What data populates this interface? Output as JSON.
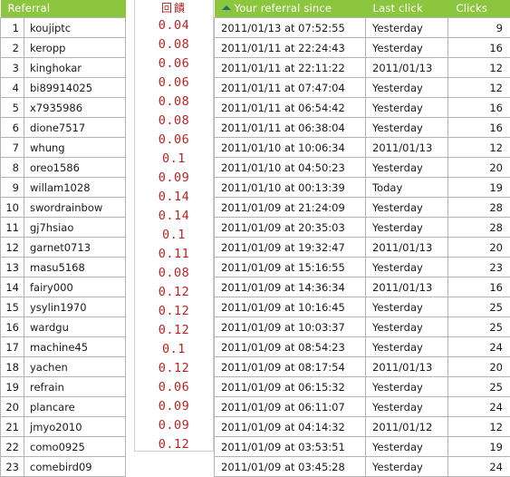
{
  "tables": {
    "left": {
      "header": {
        "referral_label": "Referral"
      },
      "rows": [
        {
          "rank": "1",
          "name": "koujiptc"
        },
        {
          "rank": "2",
          "name": "keropp"
        },
        {
          "rank": "3",
          "name": "kinghokar"
        },
        {
          "rank": "4",
          "name": "bi89914025"
        },
        {
          "rank": "5",
          "name": "x7935986"
        },
        {
          "rank": "6",
          "name": "dione7517"
        },
        {
          "rank": "7",
          "name": "whung"
        },
        {
          "rank": "8",
          "name": "oreo1586"
        },
        {
          "rank": "9",
          "name": "willam1028"
        },
        {
          "rank": "10",
          "name": "swordrainbow"
        },
        {
          "rank": "11",
          "name": "gj7hsiao"
        },
        {
          "rank": "12",
          "name": "garnet0713"
        },
        {
          "rank": "13",
          "name": "masu5168"
        },
        {
          "rank": "14",
          "name": "fairy000"
        },
        {
          "rank": "15",
          "name": "ysylin1970"
        },
        {
          "rank": "16",
          "name": "wardgu"
        },
        {
          "rank": "17",
          "name": "machine45"
        },
        {
          "rank": "18",
          "name": "yachen"
        },
        {
          "rank": "19",
          "name": "refrain"
        },
        {
          "rank": "20",
          "name": "plancare"
        },
        {
          "rank": "21",
          "name": "jmyo2010"
        },
        {
          "rank": "22",
          "name": "como0925"
        },
        {
          "rank": "23",
          "name": "comebird09"
        }
      ]
    },
    "reward": {
      "header": "回饋",
      "color": "#bb2222",
      "values": [
        "0.04",
        "0.08",
        "0.06",
        "0.06",
        "0.08",
        "0.08",
        "0.06",
        "0.1",
        "0.09",
        "0.14",
        "0.14",
        "0.1",
        "0.11",
        "0.08",
        "0.12",
        "0.12",
        "0.12",
        "0.1",
        "0.12",
        "0.06",
        "0.09",
        "0.09",
        "0.12"
      ]
    },
    "right": {
      "header": {
        "since_label": "Your referral since",
        "sort_icon": "sort-asc-icon",
        "last_click_label": "Last click",
        "clicks_label": "Clicks"
      },
      "rows": [
        {
          "since": "2011/01/13 at 07:52:55",
          "last": "Yesterday",
          "clicks": "9"
        },
        {
          "since": "2011/01/11 at 22:24:43",
          "last": "Yesterday",
          "clicks": "16"
        },
        {
          "since": "2011/01/11 at 22:11:22",
          "last": "2011/01/13",
          "clicks": "12"
        },
        {
          "since": "2011/01/11 at 07:47:04",
          "last": "Yesterday",
          "clicks": "12"
        },
        {
          "since": "2011/01/11 at 06:54:42",
          "last": "Yesterday",
          "clicks": "16"
        },
        {
          "since": "2011/01/11 at 06:38:04",
          "last": "Yesterday",
          "clicks": "16"
        },
        {
          "since": "2011/01/10 at 10:06:34",
          "last": "2011/01/13",
          "clicks": "12"
        },
        {
          "since": "2011/01/10 at 04:50:23",
          "last": "Yesterday",
          "clicks": "20"
        },
        {
          "since": "2011/01/10 at 00:13:39",
          "last": "Today",
          "clicks": "19"
        },
        {
          "since": "2011/01/09 at 21:24:09",
          "last": "Yesterday",
          "clicks": "28"
        },
        {
          "since": "2011/01/09 at 20:35:03",
          "last": "Yesterday",
          "clicks": "28"
        },
        {
          "since": "2011/01/09 at 19:32:47",
          "last": "2011/01/13",
          "clicks": "20"
        },
        {
          "since": "2011/01/09 at 15:16:55",
          "last": "Yesterday",
          "clicks": "23"
        },
        {
          "since": "2011/01/09 at 14:36:34",
          "last": "2011/01/13",
          "clicks": "16"
        },
        {
          "since": "2011/01/09 at 10:16:45",
          "last": "Yesterday",
          "clicks": "25"
        },
        {
          "since": "2011/01/09 at 10:03:37",
          "last": "Yesterday",
          "clicks": "25"
        },
        {
          "since": "2011/01/09 at 08:54:23",
          "last": "Yesterday",
          "clicks": "24"
        },
        {
          "since": "2011/01/09 at 08:17:54",
          "last": "2011/01/13",
          "clicks": "20"
        },
        {
          "since": "2011/01/09 at 06:15:32",
          "last": "Yesterday",
          "clicks": "25"
        },
        {
          "since": "2011/01/09 at 06:11:07",
          "last": "Yesterday",
          "clicks": "24"
        },
        {
          "since": "2011/01/09 at 04:14:32",
          "last": "2011/01/12",
          "clicks": "12"
        },
        {
          "since": "2011/01/09 at 03:53:51",
          "last": "Yesterday",
          "clicks": "19"
        },
        {
          "since": "2011/01/09 at 03:45:28",
          "last": "Yesterday",
          "clicks": "24"
        }
      ]
    }
  },
  "theme": {
    "header_green": "#8CC63F",
    "grid_border": "#b3b3b3",
    "reward_red": "#bb2222",
    "sort_icon_color": "#1d6e7d"
  }
}
